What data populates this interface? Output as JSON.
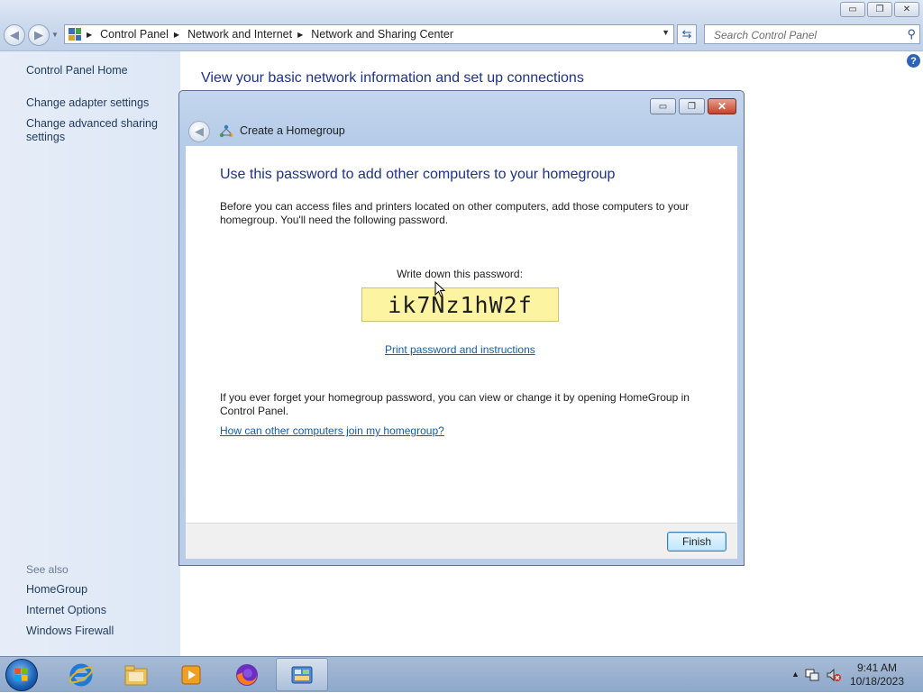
{
  "window": {
    "caption_buttons": {
      "minimize": "▭",
      "restore": "❐",
      "close": "✕"
    }
  },
  "toolbar": {
    "back_glyph": "◀",
    "forward_glyph": "▶",
    "breadcrumb": [
      "Control Panel",
      "Network and Internet",
      "Network and Sharing Center"
    ],
    "search_placeholder": "Search Control Panel",
    "icons": [
      "back-icon",
      "forward-icon",
      "control-panel-icon",
      "refresh-icon",
      "search-icon"
    ]
  },
  "sidebar": {
    "home": "Control Panel Home",
    "links": [
      "Change adapter settings",
      "Change advanced sharing\nsettings"
    ],
    "see_also_label": "See also",
    "see_also": [
      "HomeGroup",
      "Internet Options",
      "Windows Firewall"
    ]
  },
  "main": {
    "title": "View your basic network information and set up connections",
    "help": "?"
  },
  "dialog": {
    "title": "Create a Homegroup",
    "heading": "Use this password to add other computers to your homegroup",
    "intro": "Before you can access files and printers located on other computers, add those computers to your homegroup. You'll need the following password.",
    "password_label": "Write down this password:",
    "password": "ik7Nz1hW2f",
    "print_link": "Print password and instructions",
    "forget_text": "If you ever forget your homegroup password, you can view or change it by opening HomeGroup in Control Panel.",
    "join_link": "How can other computers join my homegroup?",
    "finish": "Finish"
  },
  "taskbar": {
    "items": [
      "internet-explorer",
      "windows-explorer",
      "media-player",
      "firefox",
      "control-panel"
    ],
    "active_item": "control-panel",
    "tray_arrow": "▲",
    "time": "9:41 AM",
    "date": "10/18/2023"
  },
  "colors": {
    "accent_link": "#0f5da8",
    "heading_blue": "#1e3287",
    "password_bg": "#fdf4a1"
  }
}
